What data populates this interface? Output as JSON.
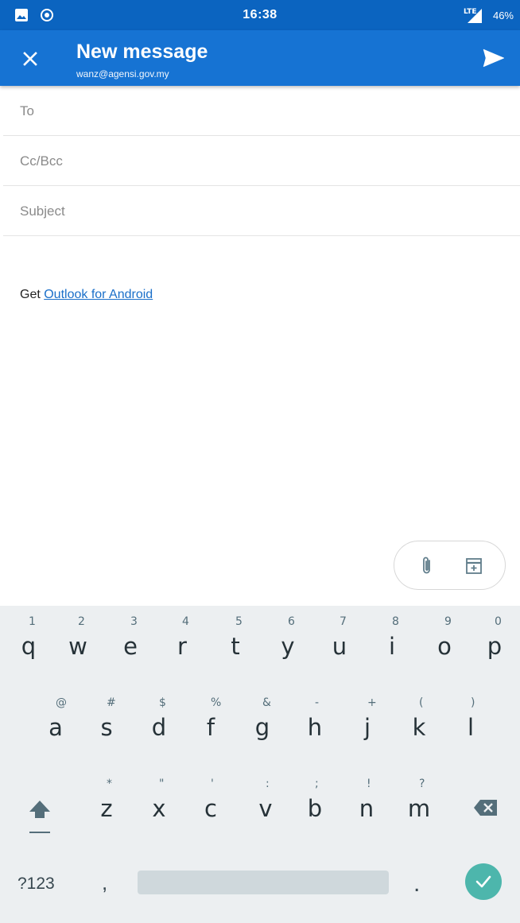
{
  "status_bar": {
    "time": "16:38",
    "battery": "46%",
    "network": "LTE",
    "left_icons": [
      "image-icon",
      "record-icon"
    ]
  },
  "app_bar": {
    "title": "New message",
    "account": "wanz@agensi.gov.my"
  },
  "fields": {
    "to_placeholder": "To",
    "ccbcc_placeholder": "Cc/Bcc",
    "subject_placeholder": "Subject"
  },
  "body": {
    "prefix": "Get ",
    "link_text": "Outlook for Android"
  },
  "attach_tools": [
    "paperclip-icon",
    "calendar-add-icon"
  ],
  "keyboard": {
    "row1": [
      {
        "key": "q",
        "hint": "1"
      },
      {
        "key": "w",
        "hint": "2"
      },
      {
        "key": "e",
        "hint": "3"
      },
      {
        "key": "r",
        "hint": "4"
      },
      {
        "key": "t",
        "hint": "5"
      },
      {
        "key": "y",
        "hint": "6"
      },
      {
        "key": "u",
        "hint": "7"
      },
      {
        "key": "i",
        "hint": "8"
      },
      {
        "key": "o",
        "hint": "9"
      },
      {
        "key": "p",
        "hint": "0"
      }
    ],
    "row2": [
      {
        "key": "a",
        "hint": "@"
      },
      {
        "key": "s",
        "hint": "#"
      },
      {
        "key": "d",
        "hint": "$"
      },
      {
        "key": "f",
        "hint": "%"
      },
      {
        "key": "g",
        "hint": "&"
      },
      {
        "key": "h",
        "hint": "-"
      },
      {
        "key": "j",
        "hint": "+"
      },
      {
        "key": "k",
        "hint": "("
      },
      {
        "key": "l",
        "hint": ")"
      }
    ],
    "row3": [
      {
        "key": "z",
        "hint": "*"
      },
      {
        "key": "x",
        "hint": "\""
      },
      {
        "key": "c",
        "hint": "'"
      },
      {
        "key": "v",
        "hint": ":"
      },
      {
        "key": "b",
        "hint": ";"
      },
      {
        "key": "n",
        "hint": "!"
      },
      {
        "key": "m",
        "hint": "?"
      }
    ],
    "symbols_label": "?123",
    "comma": ",",
    "period": "."
  }
}
